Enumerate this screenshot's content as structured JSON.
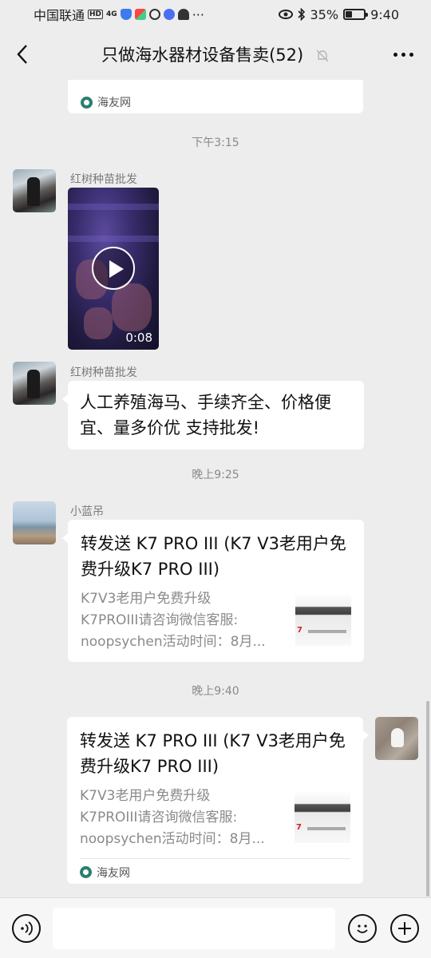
{
  "status_bar": {
    "carrier": "中国联通",
    "hd_badge": "HD",
    "network": "4G",
    "battery_percent": "35%",
    "battery_level": 0.35,
    "time": "9:40",
    "more_notifications": "···"
  },
  "header": {
    "title": "只做海水器材设备售卖(52)",
    "muted": true
  },
  "chat": {
    "top_card_source": "海友网",
    "messages": [
      {
        "kind": "time",
        "text": "下午3:15"
      },
      {
        "kind": "video",
        "sender": "红树种苗批发",
        "duration": "0:08"
      },
      {
        "kind": "text",
        "sender": "红树种苗批发",
        "text": "人工养殖海马、手续齐全、价格便宜、量多价优 支持批发!"
      },
      {
        "kind": "time",
        "text": "晚上9:25"
      },
      {
        "kind": "link",
        "sender": "小蓝吊",
        "title": "转发送 K7 PRO III (K7 V3老用户免费升级K7 PRO III)",
        "desc_lines": [
          "K7V3老用户免费升级",
          "K7PROIII请咨询微信客服:",
          "noopsychen活动时间：8月..."
        ],
        "thumb_text": "7"
      },
      {
        "kind": "time",
        "text": "晚上9:40"
      },
      {
        "kind": "link",
        "sender": "me",
        "title": "转发送 K7 PRO III (K7 V3老用户免费升级K7 PRO III)",
        "desc_lines": [
          "K7V3老用户免费升级",
          "K7PROIII请咨询微信客服:",
          "noopsychen活动时间：8月..."
        ],
        "thumb_text": "7",
        "source": "海友网"
      }
    ]
  },
  "input_bar": {
    "placeholder": ""
  },
  "icons": {
    "back": "back-arrow-icon",
    "mute": "mute-bell-icon",
    "more": "more-dots-icon",
    "voice": "voice-icon",
    "emoji": "emoji-icon",
    "plus": "plus-icon",
    "source": "haiyou-source-icon"
  }
}
